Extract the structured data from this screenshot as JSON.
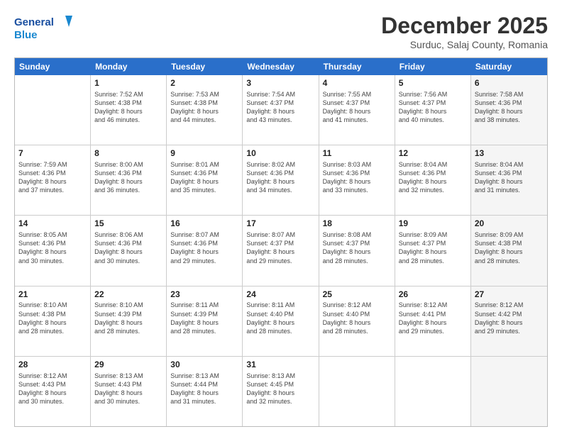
{
  "header": {
    "logo_line1": "General",
    "logo_line2": "Blue",
    "month_title": "December 2025",
    "subtitle": "Surduc, Salaj County, Romania"
  },
  "weekdays": [
    "Sunday",
    "Monday",
    "Tuesday",
    "Wednesday",
    "Thursday",
    "Friday",
    "Saturday"
  ],
  "rows": [
    [
      {
        "day": "",
        "lines": [],
        "shaded": false
      },
      {
        "day": "1",
        "lines": [
          "Sunrise: 7:52 AM",
          "Sunset: 4:38 PM",
          "Daylight: 8 hours",
          "and 46 minutes."
        ],
        "shaded": false
      },
      {
        "day": "2",
        "lines": [
          "Sunrise: 7:53 AM",
          "Sunset: 4:38 PM",
          "Daylight: 8 hours",
          "and 44 minutes."
        ],
        "shaded": false
      },
      {
        "day": "3",
        "lines": [
          "Sunrise: 7:54 AM",
          "Sunset: 4:37 PM",
          "Daylight: 8 hours",
          "and 43 minutes."
        ],
        "shaded": false
      },
      {
        "day": "4",
        "lines": [
          "Sunrise: 7:55 AM",
          "Sunset: 4:37 PM",
          "Daylight: 8 hours",
          "and 41 minutes."
        ],
        "shaded": false
      },
      {
        "day": "5",
        "lines": [
          "Sunrise: 7:56 AM",
          "Sunset: 4:37 PM",
          "Daylight: 8 hours",
          "and 40 minutes."
        ],
        "shaded": false
      },
      {
        "day": "6",
        "lines": [
          "Sunrise: 7:58 AM",
          "Sunset: 4:36 PM",
          "Daylight: 8 hours",
          "and 38 minutes."
        ],
        "shaded": true
      }
    ],
    [
      {
        "day": "7",
        "lines": [
          "Sunrise: 7:59 AM",
          "Sunset: 4:36 PM",
          "Daylight: 8 hours",
          "and 37 minutes."
        ],
        "shaded": false
      },
      {
        "day": "8",
        "lines": [
          "Sunrise: 8:00 AM",
          "Sunset: 4:36 PM",
          "Daylight: 8 hours",
          "and 36 minutes."
        ],
        "shaded": false
      },
      {
        "day": "9",
        "lines": [
          "Sunrise: 8:01 AM",
          "Sunset: 4:36 PM",
          "Daylight: 8 hours",
          "and 35 minutes."
        ],
        "shaded": false
      },
      {
        "day": "10",
        "lines": [
          "Sunrise: 8:02 AM",
          "Sunset: 4:36 PM",
          "Daylight: 8 hours",
          "and 34 minutes."
        ],
        "shaded": false
      },
      {
        "day": "11",
        "lines": [
          "Sunrise: 8:03 AM",
          "Sunset: 4:36 PM",
          "Daylight: 8 hours",
          "and 33 minutes."
        ],
        "shaded": false
      },
      {
        "day": "12",
        "lines": [
          "Sunrise: 8:04 AM",
          "Sunset: 4:36 PM",
          "Daylight: 8 hours",
          "and 32 minutes."
        ],
        "shaded": false
      },
      {
        "day": "13",
        "lines": [
          "Sunrise: 8:04 AM",
          "Sunset: 4:36 PM",
          "Daylight: 8 hours",
          "and 31 minutes."
        ],
        "shaded": true
      }
    ],
    [
      {
        "day": "14",
        "lines": [
          "Sunrise: 8:05 AM",
          "Sunset: 4:36 PM",
          "Daylight: 8 hours",
          "and 30 minutes."
        ],
        "shaded": false
      },
      {
        "day": "15",
        "lines": [
          "Sunrise: 8:06 AM",
          "Sunset: 4:36 PM",
          "Daylight: 8 hours",
          "and 30 minutes."
        ],
        "shaded": false
      },
      {
        "day": "16",
        "lines": [
          "Sunrise: 8:07 AM",
          "Sunset: 4:36 PM",
          "Daylight: 8 hours",
          "and 29 minutes."
        ],
        "shaded": false
      },
      {
        "day": "17",
        "lines": [
          "Sunrise: 8:07 AM",
          "Sunset: 4:37 PM",
          "Daylight: 8 hours",
          "and 29 minutes."
        ],
        "shaded": false
      },
      {
        "day": "18",
        "lines": [
          "Sunrise: 8:08 AM",
          "Sunset: 4:37 PM",
          "Daylight: 8 hours",
          "and 28 minutes."
        ],
        "shaded": false
      },
      {
        "day": "19",
        "lines": [
          "Sunrise: 8:09 AM",
          "Sunset: 4:37 PM",
          "Daylight: 8 hours",
          "and 28 minutes."
        ],
        "shaded": false
      },
      {
        "day": "20",
        "lines": [
          "Sunrise: 8:09 AM",
          "Sunset: 4:38 PM",
          "Daylight: 8 hours",
          "and 28 minutes."
        ],
        "shaded": true
      }
    ],
    [
      {
        "day": "21",
        "lines": [
          "Sunrise: 8:10 AM",
          "Sunset: 4:38 PM",
          "Daylight: 8 hours",
          "and 28 minutes."
        ],
        "shaded": false
      },
      {
        "day": "22",
        "lines": [
          "Sunrise: 8:10 AM",
          "Sunset: 4:39 PM",
          "Daylight: 8 hours",
          "and 28 minutes."
        ],
        "shaded": false
      },
      {
        "day": "23",
        "lines": [
          "Sunrise: 8:11 AM",
          "Sunset: 4:39 PM",
          "Daylight: 8 hours",
          "and 28 minutes."
        ],
        "shaded": false
      },
      {
        "day": "24",
        "lines": [
          "Sunrise: 8:11 AM",
          "Sunset: 4:40 PM",
          "Daylight: 8 hours",
          "and 28 minutes."
        ],
        "shaded": false
      },
      {
        "day": "25",
        "lines": [
          "Sunrise: 8:12 AM",
          "Sunset: 4:40 PM",
          "Daylight: 8 hours",
          "and 28 minutes."
        ],
        "shaded": false
      },
      {
        "day": "26",
        "lines": [
          "Sunrise: 8:12 AM",
          "Sunset: 4:41 PM",
          "Daylight: 8 hours",
          "and 29 minutes."
        ],
        "shaded": false
      },
      {
        "day": "27",
        "lines": [
          "Sunrise: 8:12 AM",
          "Sunset: 4:42 PM",
          "Daylight: 8 hours",
          "and 29 minutes."
        ],
        "shaded": true
      }
    ],
    [
      {
        "day": "28",
        "lines": [
          "Sunrise: 8:12 AM",
          "Sunset: 4:43 PM",
          "Daylight: 8 hours",
          "and 30 minutes."
        ],
        "shaded": false
      },
      {
        "day": "29",
        "lines": [
          "Sunrise: 8:13 AM",
          "Sunset: 4:43 PM",
          "Daylight: 8 hours",
          "and 30 minutes."
        ],
        "shaded": false
      },
      {
        "day": "30",
        "lines": [
          "Sunrise: 8:13 AM",
          "Sunset: 4:44 PM",
          "Daylight: 8 hours",
          "and 31 minutes."
        ],
        "shaded": false
      },
      {
        "day": "31",
        "lines": [
          "Sunrise: 8:13 AM",
          "Sunset: 4:45 PM",
          "Daylight: 8 hours",
          "and 32 minutes."
        ],
        "shaded": false
      },
      {
        "day": "",
        "lines": [],
        "shaded": false
      },
      {
        "day": "",
        "lines": [],
        "shaded": false
      },
      {
        "day": "",
        "lines": [],
        "shaded": true
      }
    ]
  ]
}
